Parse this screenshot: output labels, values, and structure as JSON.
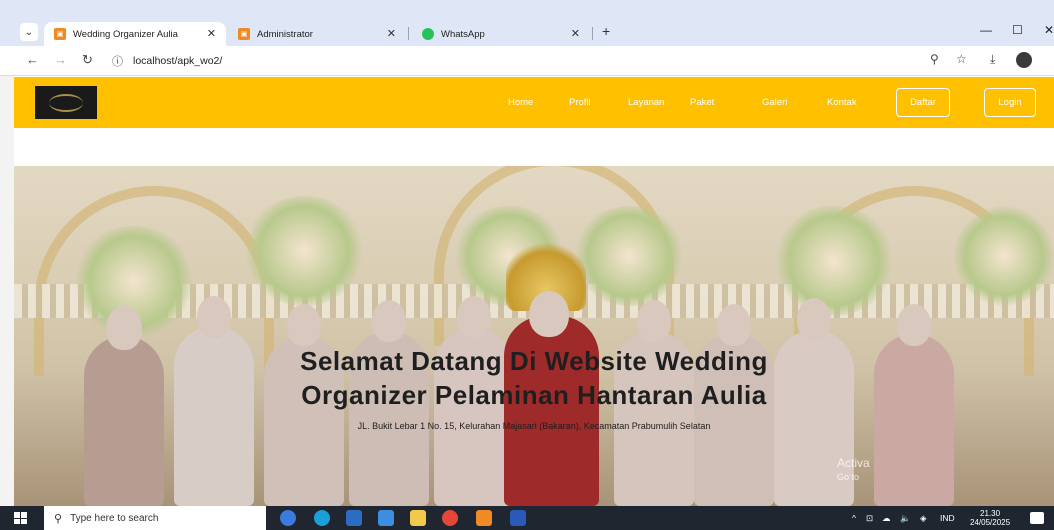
{
  "browser": {
    "tabs": [
      {
        "label": "Wedding Organizer Aulia",
        "active": true,
        "favicon": "orange-square-icon"
      },
      {
        "label": "Administrator",
        "active": false,
        "favicon": "orange-square-icon"
      },
      {
        "label": "WhatsApp",
        "active": false,
        "favicon": "whatsapp-icon"
      }
    ],
    "url": "localhost/apk_wo2/"
  },
  "site": {
    "accent_color": "#ffc000",
    "nav": [
      "Home",
      "Profil",
      "Layanan",
      "Paket",
      "Galeri",
      "Kontak"
    ],
    "buttons": {
      "daftar": "Daftar",
      "login": "Login"
    },
    "hero": {
      "title_line1": "Selamat Datang Di Website Wedding",
      "title_line2": "Organizer Pelaminan Hantaran Aulia",
      "address": "JL. Bukit Lebar 1 No. 15, Kelurahan Majasari (Bakaran), Kecamatan Prabumulih Selatan"
    },
    "watermark": {
      "line1": "Activa",
      "line2": "Go to"
    }
  },
  "taskbar": {
    "search_placeholder": "Type here to search",
    "language": "IND",
    "time": "21.30",
    "date": "24/05/2025"
  }
}
